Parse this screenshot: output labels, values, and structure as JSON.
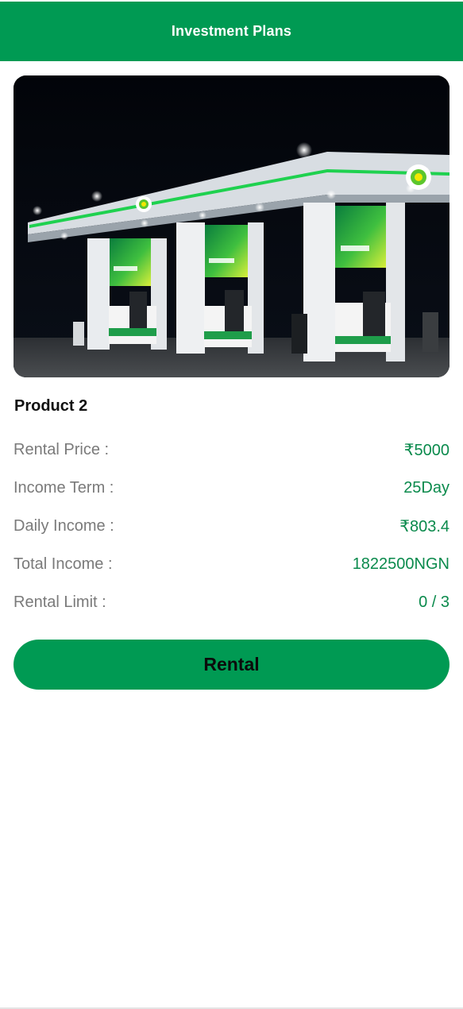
{
  "header": {
    "title": "Investment Plans"
  },
  "product": {
    "name": "Product 2",
    "rows": [
      {
        "label": "Rental Price :",
        "value": "₹5000"
      },
      {
        "label": "Income Term :",
        "value": "25Day"
      },
      {
        "label": "Daily Income :",
        "value": "₹803.4"
      },
      {
        "label": "Total Income :",
        "value": "1822500NGN"
      },
      {
        "label": "Rental Limit :",
        "value": "0 / 3"
      }
    ]
  },
  "rental_button": {
    "label": "Rental"
  },
  "colors": {
    "brand_green": "#009a53",
    "value_green": "#0a8a4c",
    "label_gray": "#7a7a7a"
  }
}
